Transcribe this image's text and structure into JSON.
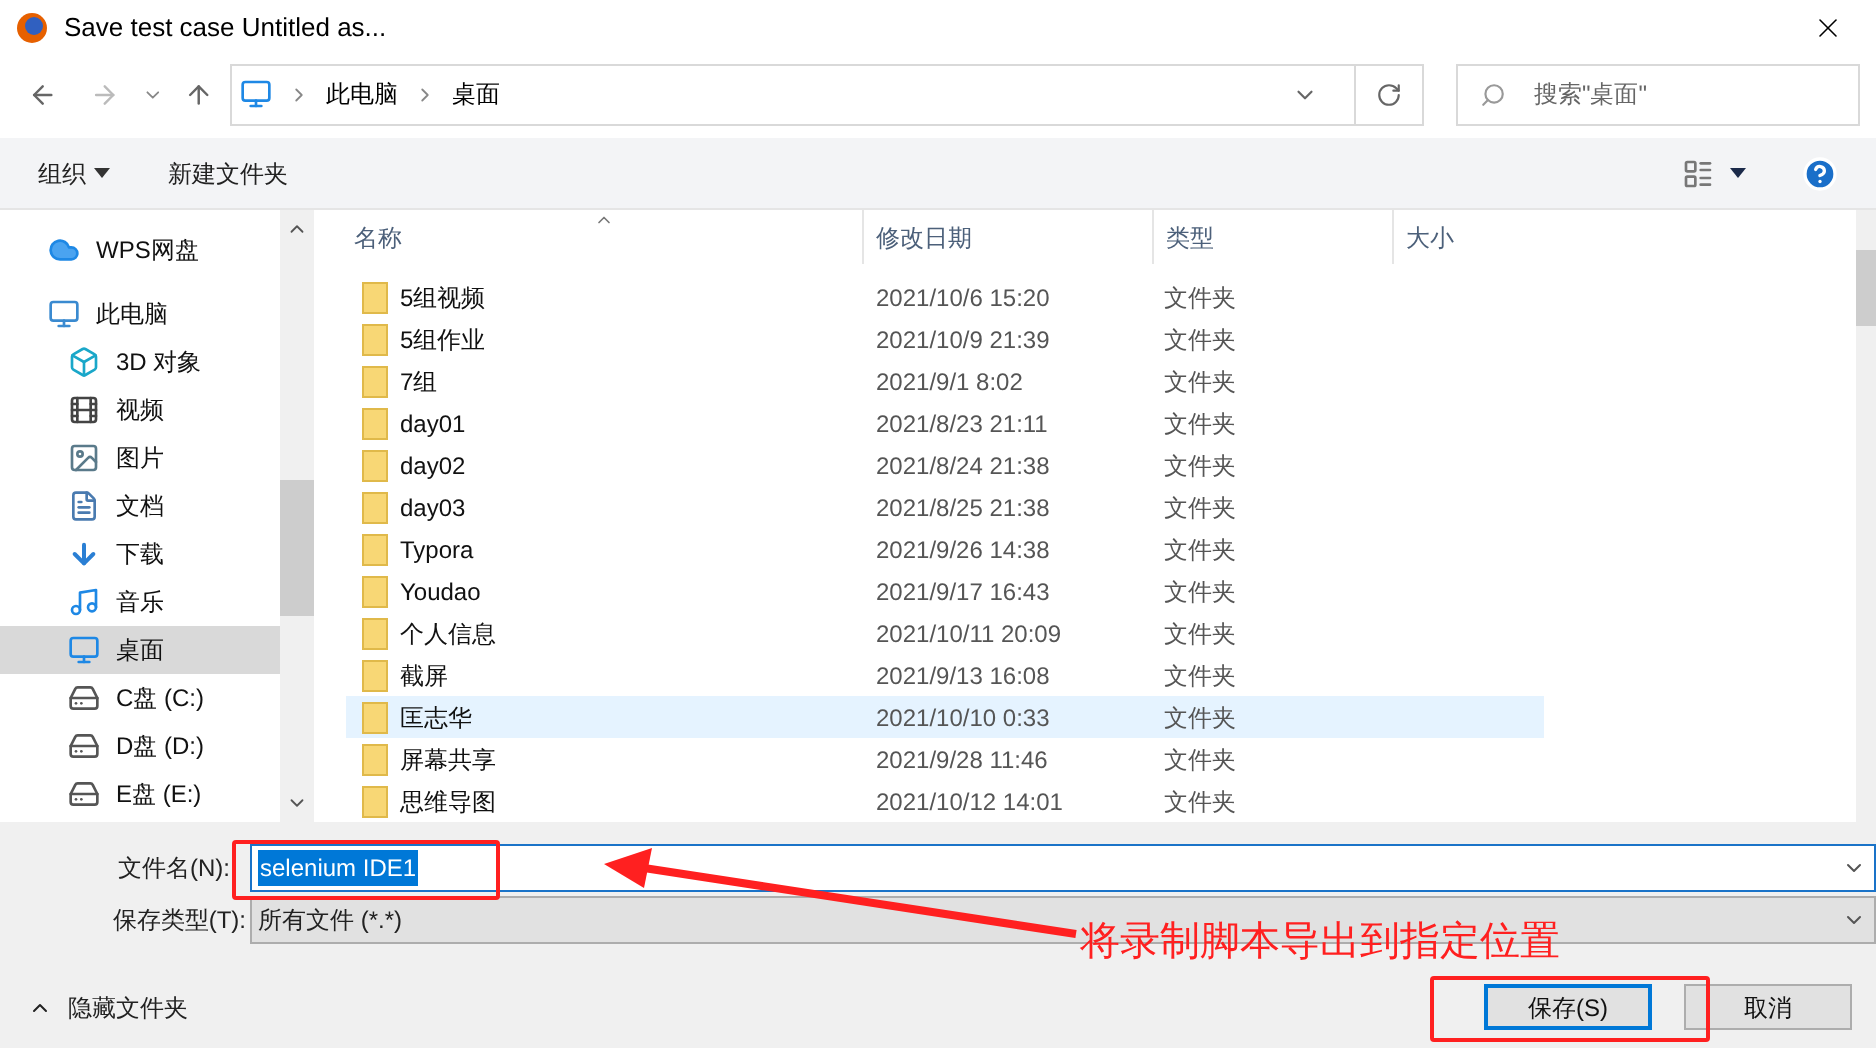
{
  "window": {
    "title": "Save test case Untitled as..."
  },
  "breadcrumb": [
    "此电脑",
    "桌面"
  ],
  "search": {
    "placeholder": "搜索\"桌面\""
  },
  "toolbar": {
    "organize": "组织",
    "new_folder": "新建文件夹"
  },
  "sidebar": {
    "items": [
      {
        "label": "WPS网盘",
        "kind": "cloud",
        "selected": false
      },
      {
        "label": "此电脑",
        "kind": "computer",
        "selected": false,
        "children": [
          {
            "label": "3D 对象",
            "kind": "cube",
            "selected": false
          },
          {
            "label": "视频",
            "kind": "video",
            "selected": false
          },
          {
            "label": "图片",
            "kind": "image",
            "selected": false
          },
          {
            "label": "文档",
            "kind": "document",
            "selected": false
          },
          {
            "label": "下载",
            "kind": "download",
            "selected": false
          },
          {
            "label": "音乐",
            "kind": "music",
            "selected": false
          },
          {
            "label": "桌面",
            "kind": "desktop",
            "selected": true
          },
          {
            "label": "C盘 (C:)",
            "kind": "drive",
            "selected": false
          },
          {
            "label": "D盘 (D:)",
            "kind": "drive",
            "selected": false
          },
          {
            "label": "E盘 (E:)",
            "kind": "drive",
            "selected": false
          }
        ]
      }
    ]
  },
  "table": {
    "columns": [
      "名称",
      "修改日期",
      "类型",
      "大小"
    ],
    "rows": [
      {
        "name": "5组视频",
        "date": "2021/10/6 15:20",
        "type": "文件夹",
        "selected": false
      },
      {
        "name": "5组作业",
        "date": "2021/10/9 21:39",
        "type": "文件夹",
        "selected": false
      },
      {
        "name": "7组",
        "date": "2021/9/1 8:02",
        "type": "文件夹",
        "selected": false
      },
      {
        "name": "day01",
        "date": "2021/8/23 21:11",
        "type": "文件夹",
        "selected": false
      },
      {
        "name": "day02",
        "date": "2021/8/24 21:38",
        "type": "文件夹",
        "selected": false
      },
      {
        "name": "day03",
        "date": "2021/8/25 21:38",
        "type": "文件夹",
        "selected": false
      },
      {
        "name": "Typora",
        "date": "2021/9/26 14:38",
        "type": "文件夹",
        "selected": false
      },
      {
        "name": "Youdao",
        "date": "2021/9/17 16:43",
        "type": "文件夹",
        "selected": false
      },
      {
        "name": "个人信息",
        "date": "2021/10/11 20:09",
        "type": "文件夹",
        "selected": false
      },
      {
        "name": "截屏",
        "date": "2021/9/13 16:08",
        "type": "文件夹",
        "selected": false
      },
      {
        "name": "匡志华",
        "date": "2021/10/10 0:33",
        "type": "文件夹",
        "selected": true
      },
      {
        "name": "屏幕共享",
        "date": "2021/9/28 11:46",
        "type": "文件夹",
        "selected": false
      },
      {
        "name": "思维导图",
        "date": "2021/10/12 14:01",
        "type": "文件夹",
        "selected": false
      }
    ]
  },
  "file_name": {
    "label": "文件名(N):",
    "value": "selenium IDE1"
  },
  "file_type": {
    "label": "保存类型(T):",
    "value": "所有文件 (*.*)"
  },
  "hide_folders": "隐藏文件夹",
  "buttons": [
    {
      "label": "保存(S)",
      "kind": "primary"
    },
    {
      "label": "取消",
      "kind": "normal"
    }
  ],
  "annotation": {
    "text": "将录制脚本导出到指定位置"
  }
}
